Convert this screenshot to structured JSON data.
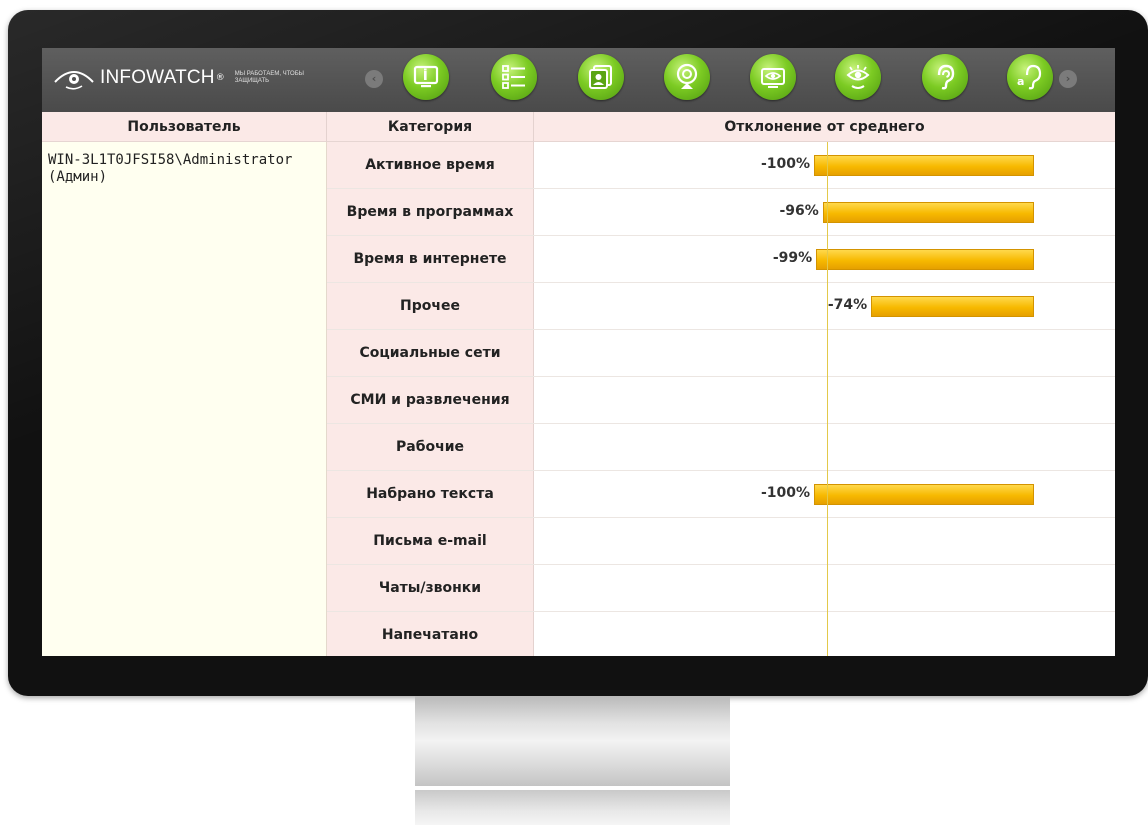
{
  "app": {
    "brand": "INFOWATCH",
    "brand_mark": "®",
    "tagline": "МЫ РАБОТАЕМ, ЧТОБЫ ЗАЩИЩАТЬ",
    "accent_green": "#7ccb23",
    "bar_color": "#f7b900",
    "header_bg": "#fbe9e7"
  },
  "toolbar": {
    "prev_icon": "chevron-left-icon",
    "next_icon": "chevron-right-icon",
    "tools": [
      {
        "icon": "monitor-info-icon"
      },
      {
        "icon": "checklist-icon"
      },
      {
        "icon": "contacts-icon"
      },
      {
        "icon": "webcam-icon"
      },
      {
        "icon": "screen-view-icon"
      },
      {
        "icon": "eye-monitor-icon"
      },
      {
        "icon": "ear-icon"
      },
      {
        "icon": "ear-text-icon"
      }
    ]
  },
  "table": {
    "headers": {
      "user": "Пользователь",
      "category": "Категория",
      "deviation": "Отклонение от среднего"
    },
    "user": "WIN-3L1T0JFSI58\\Administrator\n(Админ)",
    "rows": [
      {
        "category": "Активное время",
        "value": "-100%",
        "deviation": -100
      },
      {
        "category": "Время в программах",
        "value": "-96%",
        "deviation": -96
      },
      {
        "category": "Время в интернете",
        "value": "-99%",
        "deviation": -99
      },
      {
        "category": "Прочее",
        "value": "-74%",
        "deviation": -74
      },
      {
        "category": "Социальные сети",
        "value": "",
        "deviation": null
      },
      {
        "category": "СМИ и развлечения",
        "value": "",
        "deviation": null
      },
      {
        "category": "Рабочие",
        "value": "",
        "deviation": null
      },
      {
        "category": "Набрано текста",
        "value": "-100%",
        "deviation": -100
      },
      {
        "category": "Письма e-mail",
        "value": "",
        "deviation": null
      },
      {
        "category": "Чаты/звонки",
        "value": "",
        "deviation": null
      },
      {
        "category": "Напечатано",
        "value": "",
        "deviation": null
      }
    ]
  }
}
